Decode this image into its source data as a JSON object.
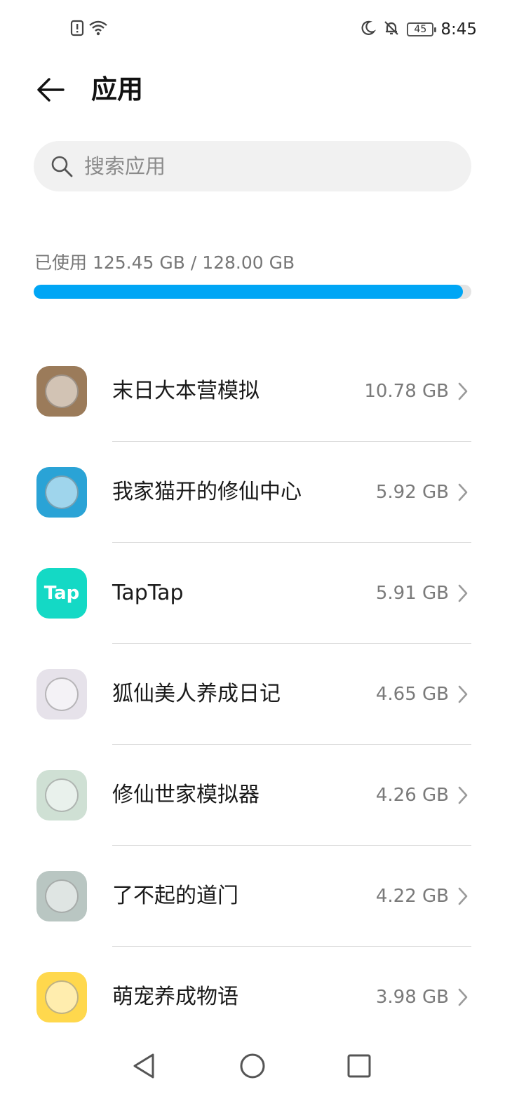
{
  "status_bar": {
    "left_icons": [
      "alert-sim-icon",
      "wifi-icon"
    ],
    "right_icons": [
      "moon-icon",
      "bell-muted-icon",
      "battery-icon"
    ],
    "battery_level": "45",
    "time": "8:45"
  },
  "header": {
    "back_icon": "arrow-left-icon",
    "title": "应用"
  },
  "search": {
    "icon": "search-icon",
    "placeholder": "搜索应用"
  },
  "storage": {
    "label": "已使用 125.45 GB / 128.00 GB",
    "used_fraction": 0.98,
    "bar_color": "#00a6f5"
  },
  "apps": [
    {
      "name": "末日大本营模拟",
      "size": "10.78 GB",
      "icon_color": "#9b7b5a"
    },
    {
      "name": "我家猫开的修仙中心",
      "size": "5.92 GB",
      "icon_color": "#2aa3d6"
    },
    {
      "name": "TapTap",
      "size": "5.91 GB",
      "icon_color": "#14d9c5",
      "icon_text": "Tap"
    },
    {
      "name": "狐仙美人养成日记",
      "size": "4.65 GB",
      "icon_color": "#e6e2ea"
    },
    {
      "name": "修仙世家模拟器",
      "size": "4.26 GB",
      "icon_color": "#cfe0d4"
    },
    {
      "name": "了不起的道门",
      "size": "4.22 GB",
      "icon_color": "#b9c6c2"
    },
    {
      "name": "萌宠养成物语",
      "size": "3.98 GB",
      "icon_color": "#ffd84d"
    }
  ],
  "nav_bar": {
    "back_icon": "nav-back-triangle-icon",
    "home_icon": "nav-home-circle-icon",
    "recents_icon": "nav-recents-square-icon"
  }
}
